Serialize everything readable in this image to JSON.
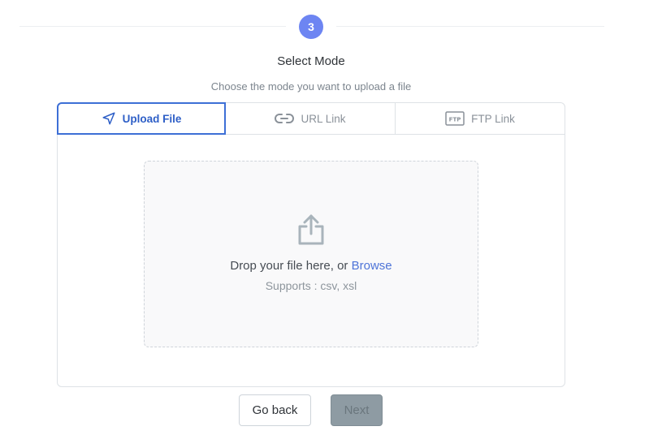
{
  "stepper": {
    "current_step": "3"
  },
  "header": {
    "title": "Select Mode",
    "subtitle": "Choose the mode you want to upload a file"
  },
  "tabs": [
    {
      "label": "Upload File",
      "icon": "send-icon",
      "active": true
    },
    {
      "label": "URL Link",
      "icon": "link-icon",
      "active": false
    },
    {
      "label": "FTP Link",
      "icon": "ftp-icon",
      "active": false
    }
  ],
  "ftp_badge": "FTP",
  "dropzone": {
    "prompt": "Drop your file here, or",
    "browse_label": "Browse",
    "supports": "Supports : csv, xsl",
    "icon": "share-upload-icon"
  },
  "actions": {
    "back_label": "Go back",
    "next_label": "Next"
  },
  "colors": {
    "accent": "#3d6fd6",
    "step_circle": "#6d85f2",
    "next_disabled": "#8e9ba3"
  }
}
